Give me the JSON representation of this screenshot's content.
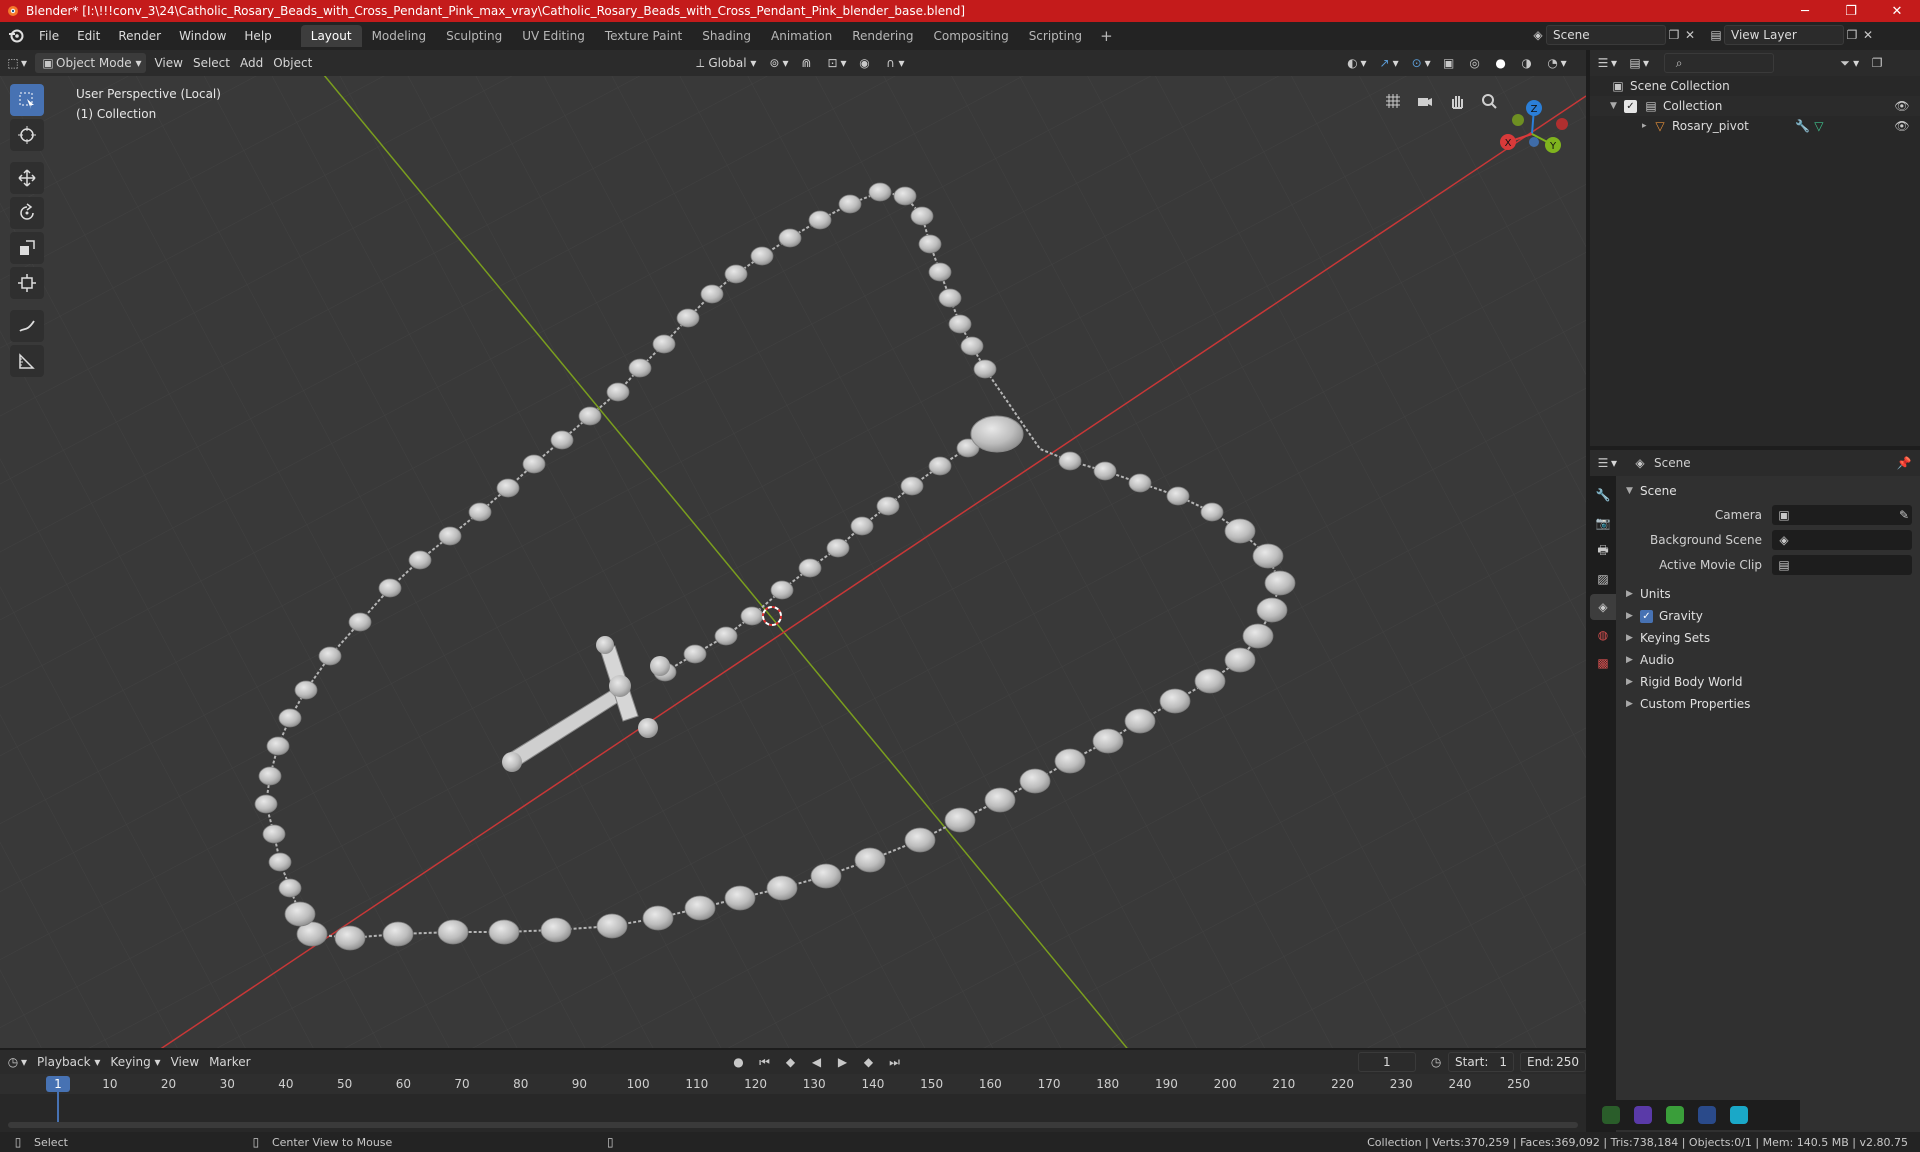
{
  "window": {
    "title": "Blender* [I:\\!!!conv_3\\24\\Catholic_Rosary_Beads_with_Cross_Pendant_Pink_max_vray\\Catholic_Rosary_Beads_with_Cross_Pendant_Pink_blender_base.blend]",
    "minimize": "─",
    "maximize": "❐",
    "close": "✕"
  },
  "menu": [
    "File",
    "Edit",
    "Render",
    "Window",
    "Help"
  ],
  "workspaces": [
    {
      "label": "Layout",
      "active": true
    },
    {
      "label": "Modeling"
    },
    {
      "label": "Sculpting"
    },
    {
      "label": "UV Editing"
    },
    {
      "label": "Texture Paint"
    },
    {
      "label": "Shading"
    },
    {
      "label": "Animation"
    },
    {
      "label": "Rendering"
    },
    {
      "label": "Compositing"
    },
    {
      "label": "Scripting"
    }
  ],
  "workspace_add": "+",
  "scene_selector": "Scene",
  "view_layer": "View Layer",
  "viewport_header": {
    "mode": "Object Mode",
    "menus": [
      "View",
      "Select",
      "Add",
      "Object"
    ],
    "orientation": "Global"
  },
  "viewport": {
    "perspective": "User Perspective (Local)",
    "collection": "(1) Collection"
  },
  "gizmo": {
    "z": "Z",
    "x": "X",
    "y": "Y"
  },
  "outliner": {
    "root": "Scene Collection",
    "collection": "Collection",
    "object": "Rosary_pivot"
  },
  "properties": {
    "context": "Scene",
    "panel": "Scene",
    "camera_label": "Camera",
    "background_label": "Background Scene",
    "movie_clip_label": "Active Movie Clip",
    "sections": [
      "Units",
      "Gravity",
      "Keying Sets",
      "Audio",
      "Rigid Body World",
      "Custom Properties"
    ]
  },
  "timeline": {
    "menus": [
      "Playback",
      "Keying",
      "View",
      "Marker"
    ],
    "current_frame": "1",
    "start_label": "Start:",
    "start": "1",
    "end_label": "End:",
    "end": "250",
    "ticks": [
      "10",
      "20",
      "30",
      "40",
      "50",
      "60",
      "70",
      "80",
      "90",
      "100",
      "110",
      "120",
      "130",
      "140",
      "150",
      "160",
      "170",
      "180",
      "190",
      "200",
      "210",
      "220",
      "230",
      "240",
      "250"
    ]
  },
  "statusbar": {
    "select": "Select",
    "center": "Center View to Mouse",
    "stats": "Collection | Verts:370,259 | Faces:369,092 | Tris:738,184 | Objects:0/1 | Mem: 140.5 MB | v2.80.75"
  },
  "colors": {
    "accent": "#4772b3",
    "titlebar": "#c41b1b",
    "x_axis": "#c83737",
    "y_axis": "#7a9e1e"
  }
}
